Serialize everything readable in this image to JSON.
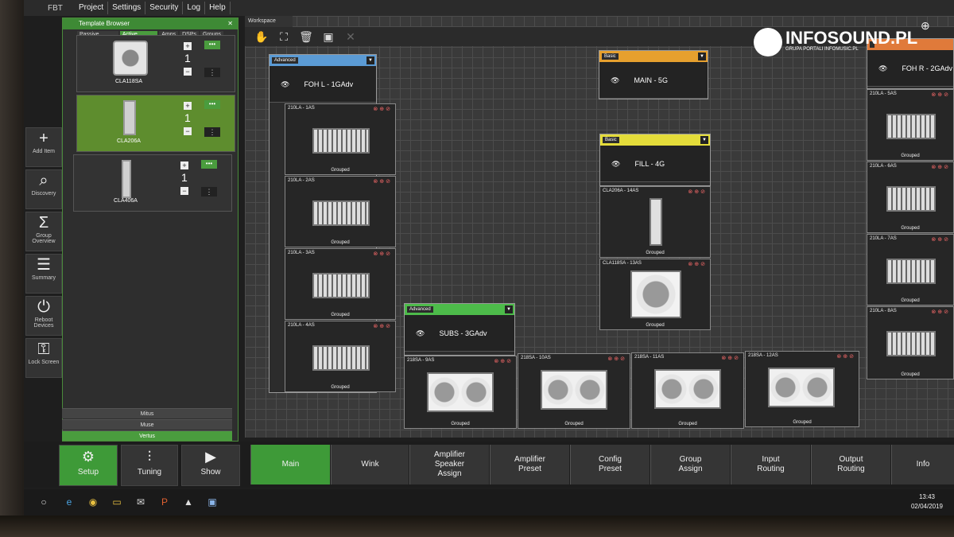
{
  "menubar": {
    "app": "FBT",
    "menus": [
      "Project",
      "Settings",
      "Security",
      "Log",
      "Help"
    ]
  },
  "leftnav": [
    {
      "label": "Add Item",
      "icon": "plus-icon"
    },
    {
      "label": "Discovery",
      "icon": "search-icon"
    },
    {
      "label": "Group Overview",
      "icon": "sigma-icon"
    },
    {
      "label": "Summary",
      "icon": "list-icon"
    },
    {
      "label": "Reboot Devices",
      "icon": "power-icon"
    },
    {
      "label": "Lock Screen",
      "icon": "lock-user-icon"
    }
  ],
  "template_browser": {
    "title": "Template Browser",
    "tabs": [
      "Passive Speakers",
      "Active Speakers",
      "Amps",
      "DSPs",
      "Groups"
    ],
    "speakers": [
      {
        "name": "CLA118SA",
        "count": "1"
      },
      {
        "name": "CLA206A",
        "count": "1"
      },
      {
        "name": "CLA406A",
        "count": "1"
      }
    ],
    "footer_items": [
      "Mitus",
      "Muse",
      "Vertus"
    ]
  },
  "workspace": {
    "title": "Workspace",
    "groups": [
      {
        "badge": "Advanced",
        "name": "FOH L - 1GAdv",
        "color": "#5b9bd5",
        "cabinets": [
          {
            "id": "210LA - 1AS",
            "status": "Grouped"
          },
          {
            "id": "210LA - 2AS",
            "status": "Grouped"
          },
          {
            "id": "210LA - 3AS",
            "status": "Grouped"
          },
          {
            "id": "210LA - 4AS",
            "status": "Grouped"
          }
        ]
      },
      {
        "badge": "Basic",
        "name": "MAIN - 5G",
        "color": "#e6a02e",
        "cabinets": []
      },
      {
        "badge": "Basic",
        "name": "FILL - 4G",
        "color": "#e4dc3a",
        "cabinets": [
          {
            "id": "CLA206A - 14AS",
            "status": "Grouped"
          },
          {
            "id": "CLA118SA - 13AS",
            "status": "Grouped"
          }
        ]
      },
      {
        "badge": "Advanced",
        "name": "SUBS - 3GAdv",
        "color": "#4dbb4a",
        "cabinets": [
          {
            "id": "218SA - 9AS",
            "status": "Grouped"
          },
          {
            "id": "218SA - 10AS",
            "status": "Grouped"
          },
          {
            "id": "218SA - 11AS",
            "status": "Grouped"
          },
          {
            "id": "218SA - 12AS",
            "status": "Grouped"
          }
        ]
      },
      {
        "badge": "",
        "name": "FOH R - 2GAdv",
        "color": "#e07a3a",
        "cabinets": [
          {
            "id": "210LA - 5AS",
            "status": "Grouped"
          },
          {
            "id": "210LA - 6AS",
            "status": "Grouped"
          },
          {
            "id": "210LA - 7AS",
            "status": "Grouped"
          },
          {
            "id": "210LA - 8AS",
            "status": "Grouped"
          }
        ]
      }
    ]
  },
  "modes": [
    {
      "label": "Setup",
      "icon": "gear-icon"
    },
    {
      "label": "Tuning",
      "icon": "sliders-icon"
    },
    {
      "label": "Show",
      "icon": "play-icon"
    }
  ],
  "workflow_tabs": [
    "Main",
    "Wink",
    "Amplifier Speaker Assign",
    "Amplifier Preset",
    "Config Preset",
    "Group Assign",
    "Input Routing",
    "Output Routing",
    "Info"
  ],
  "clock": {
    "time": "13:43",
    "date": "02/04/2019"
  },
  "watermark": {
    "brand": "INFOSOUND.PL",
    "sub": "GRUPA PORTALI INFOMUSIC.PL"
  }
}
